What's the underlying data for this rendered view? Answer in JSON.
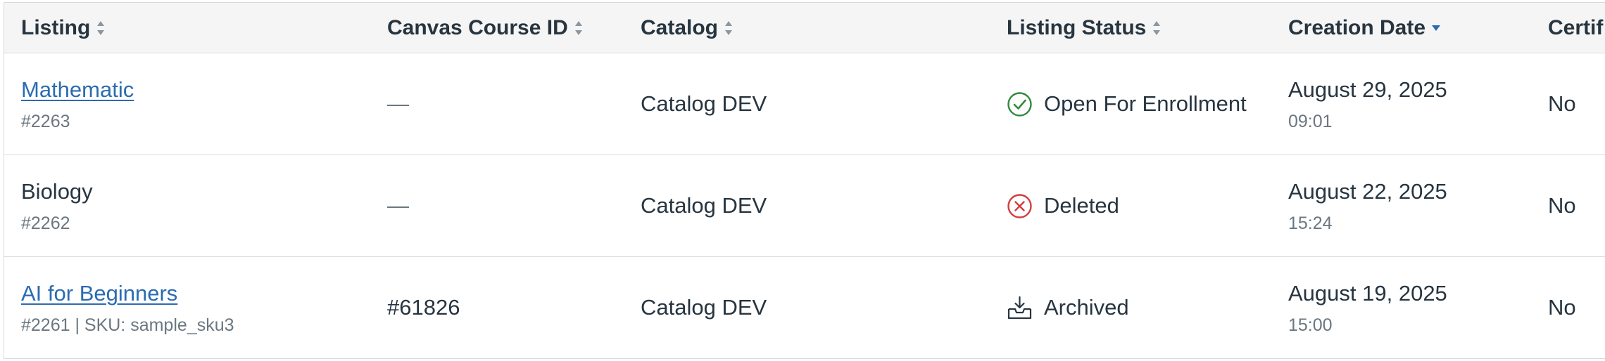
{
  "header": {
    "listing": "Listing",
    "course_id": "Canvas Course ID",
    "catalog": "Catalog",
    "status": "Listing Status",
    "creation_date": "Creation Date",
    "certificate": "Certif"
  },
  "rows": [
    {
      "title": "Mathematic",
      "title_is_link": true,
      "subtitle": "#2263",
      "course_id": "—",
      "catalog": "Catalog DEV",
      "status": "Open For Enrollment",
      "status_icon": "check-circle-icon",
      "date": "August 29, 2025",
      "time": "09:01",
      "certificate": "No"
    },
    {
      "title": "Biology",
      "title_is_link": false,
      "subtitle": "#2262",
      "course_id": "—",
      "catalog": "Catalog DEV",
      "status": "Deleted",
      "status_icon": "x-circle-icon",
      "date": "August 22, 2025",
      "time": "15:24",
      "certificate": "No"
    },
    {
      "title": "AI for Beginners",
      "title_is_link": true,
      "subtitle": "#2261 | SKU: sample_sku3",
      "course_id": "#61826",
      "catalog": "Catalog DEV",
      "status": "Archived",
      "status_icon": "archive-icon",
      "date": "August 19, 2025",
      "time": "15:00",
      "certificate": "No"
    }
  ],
  "colors": {
    "link": "#2b6bb1",
    "success": "#2f8a3b",
    "danger": "#d23c3c",
    "text": "#273540",
    "muted": "#6b7780",
    "header_bg": "#f5f5f5",
    "sort_active": "#2b6bb1"
  }
}
